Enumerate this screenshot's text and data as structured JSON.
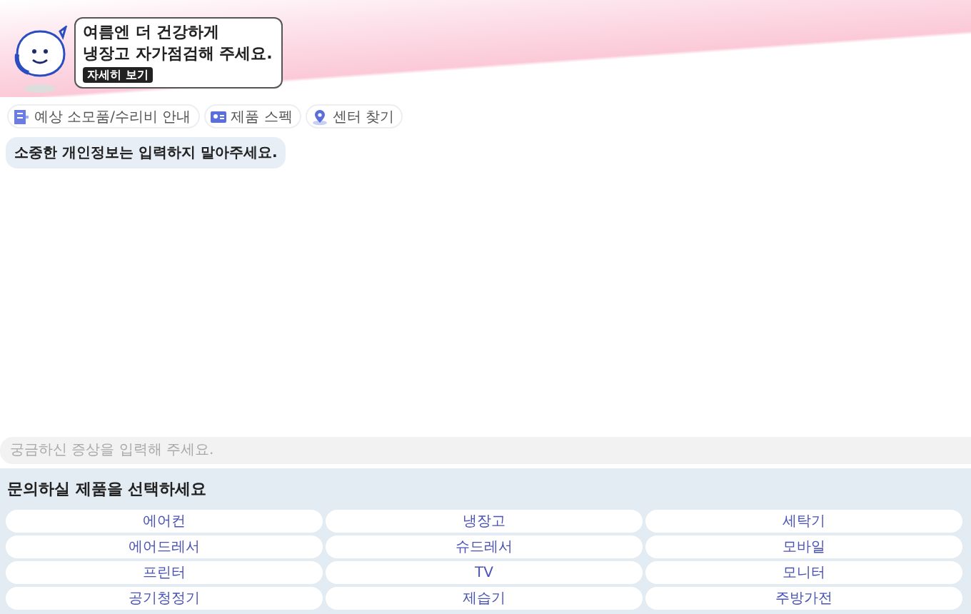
{
  "banner": {
    "headline": [
      "여름엔 더 건강하게",
      "냉장고 자가점검해 주세요."
    ],
    "link": "자세히 보기"
  },
  "quick_links": [
    {
      "kind": "cost",
      "label": "예상 소모품/수리비 안내"
    },
    {
      "kind": "spec",
      "label": "제품 스펙"
    },
    {
      "kind": "center",
      "label": "센터 찾기"
    }
  ],
  "notice": "소중한 개인정보는 입력하지 말아주세요.",
  "chat_input": {
    "placeholder": "궁금하신 증상을 입력해 주세요."
  },
  "product_picker": {
    "title": "문의하실 제품을 선택하세요",
    "products": [
      "에어컨",
      "냉장고",
      "세탁기",
      "에어드레서",
      "슈드레서",
      "모바일",
      "프린터",
      "TV",
      "모니터",
      "공기청정기",
      "제습기",
      "주방가전"
    ]
  }
}
